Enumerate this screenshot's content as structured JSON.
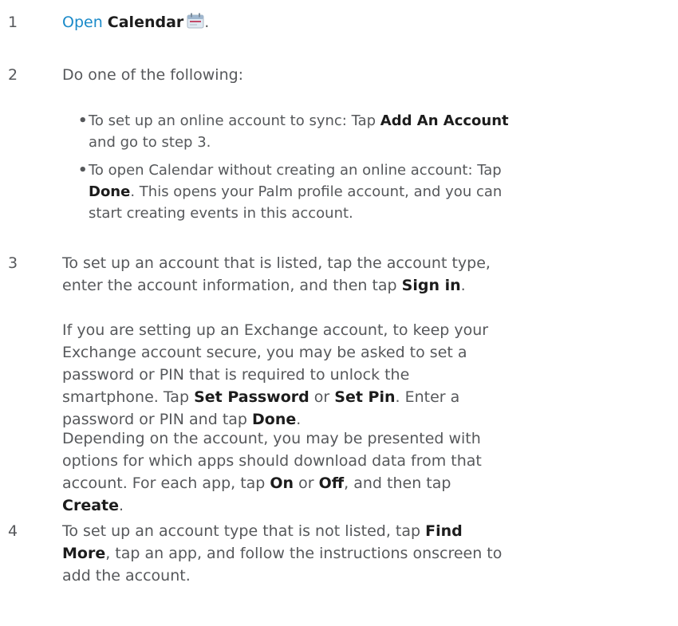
{
  "steps": [
    {
      "number": "1",
      "link_text": "Open",
      "app_name": "Calendar",
      "icon": "calendar-icon",
      "trailing": "."
    },
    {
      "number": "2",
      "intro": "Do one of the following:",
      "bullets": [
        {
          "bullet_char": "•",
          "text_before": "To set up an online account to sync: Tap ",
          "bold": "Add An Account",
          "text_after": " and go to step 3."
        },
        {
          "bullet_char": "•",
          "text_before": "To open Calendar without creating an online account: Tap ",
          "bold": "Done",
          "text_after": ". This opens your Palm profile account, and you can start creating events in this account."
        }
      ]
    },
    {
      "number": "3",
      "p1_before": "To set up an account that is listed, tap the account type, enter the account information, and then tap ",
      "p1_bold": "Sign in",
      "p1_after": ".",
      "p2_text1": "If you are setting up an Exchange account, to keep your Exchange account secure, you may be asked to set a password or PIN that is required to unlock the smartphone. Tap ",
      "p2_bold1": "Set Password",
      "p2_text2": " or ",
      "p2_bold2": "Set Pin",
      "p2_text3": ". Enter a password or PIN and tap ",
      "p2_bold3": "Done",
      "p2_text4": ".",
      "p3_text1": "Depending on the account, you may be presented with options for which apps should download data from that account. For each app, tap ",
      "p3_bold1": "On",
      "p3_text2": " or ",
      "p3_bold2": "Off",
      "p3_text3": ", and then tap ",
      "p3_bold3": "Create",
      "p3_text4": "."
    },
    {
      "number": "4",
      "text_before": "To set up an account type that is not listed, tap ",
      "bold": "Find More",
      "text_after": ", tap an app, and follow the instructions onscreen to add the account."
    }
  ]
}
